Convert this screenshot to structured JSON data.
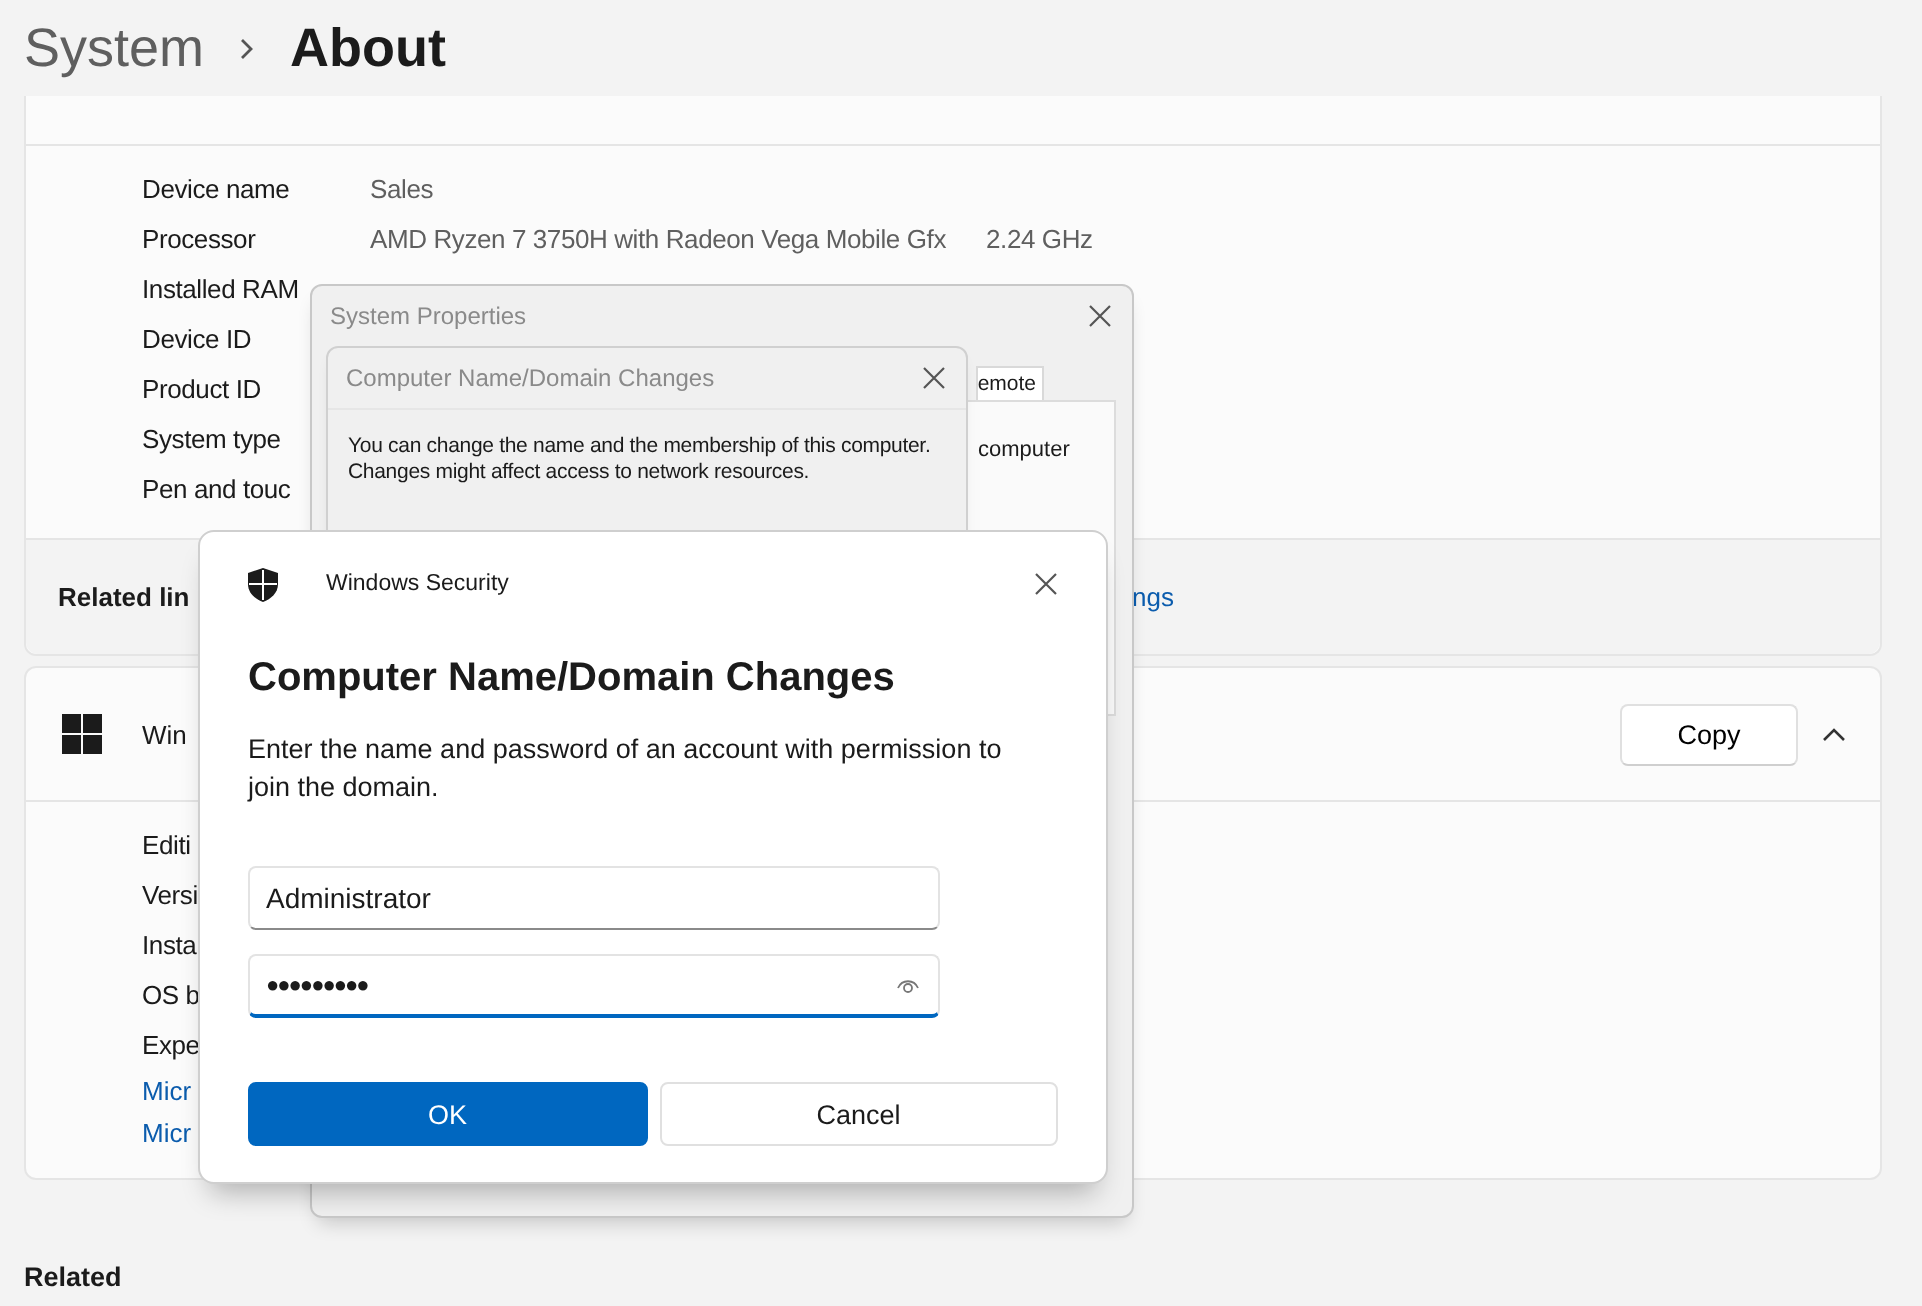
{
  "header": {
    "breadcrumb": [
      {
        "label": "System",
        "selected": false
      },
      {
        "label": "About",
        "selected": true
      }
    ]
  },
  "device_specs": {
    "rows": [
      {
        "label": "Device name",
        "value": "Sales"
      },
      {
        "label": "Processor",
        "value": "AMD Ryzen 7 3750H with Radeon Vega Mobile Gfx",
        "extra": "2.24 GHz"
      },
      {
        "label": "Installed RAM"
      },
      {
        "label": "Device ID"
      },
      {
        "label": "Product ID"
      },
      {
        "label": "System type"
      },
      {
        "label": "Pen and touc"
      }
    ],
    "related_links": {
      "label": "Related lin",
      "link": "ngs"
    }
  },
  "windows_specs": {
    "title": "Win",
    "copy_button": "Copy",
    "expanded": true,
    "rows": [
      {
        "label": "Editi"
      },
      {
        "label": "Versi"
      },
      {
        "label": "Insta"
      },
      {
        "label": "OS b"
      },
      {
        "label": "Expe"
      }
    ],
    "links": [
      "Micr",
      "Micr"
    ]
  },
  "related": {
    "heading": "Related"
  },
  "system_properties": {
    "title": "System Properties",
    "tab": "emote",
    "text": "computer"
  },
  "domain_changes": {
    "title": "Computer Name/Domain Changes",
    "message": "You can change the name and the membership of this computer. Changes might affect access to network resources."
  },
  "security_dialog": {
    "app_name": "Windows Security",
    "title": "Computer Name/Domain Changes",
    "message": "Enter the name and password of an account with permission to join the domain.",
    "username": {
      "value": "Administrator"
    },
    "password": {
      "value": "●●●●●●●●●",
      "focused": true
    },
    "buttons": [
      {
        "label": "OK",
        "kind": "primary"
      },
      {
        "label": "Cancel",
        "kind": "secondary"
      }
    ]
  }
}
